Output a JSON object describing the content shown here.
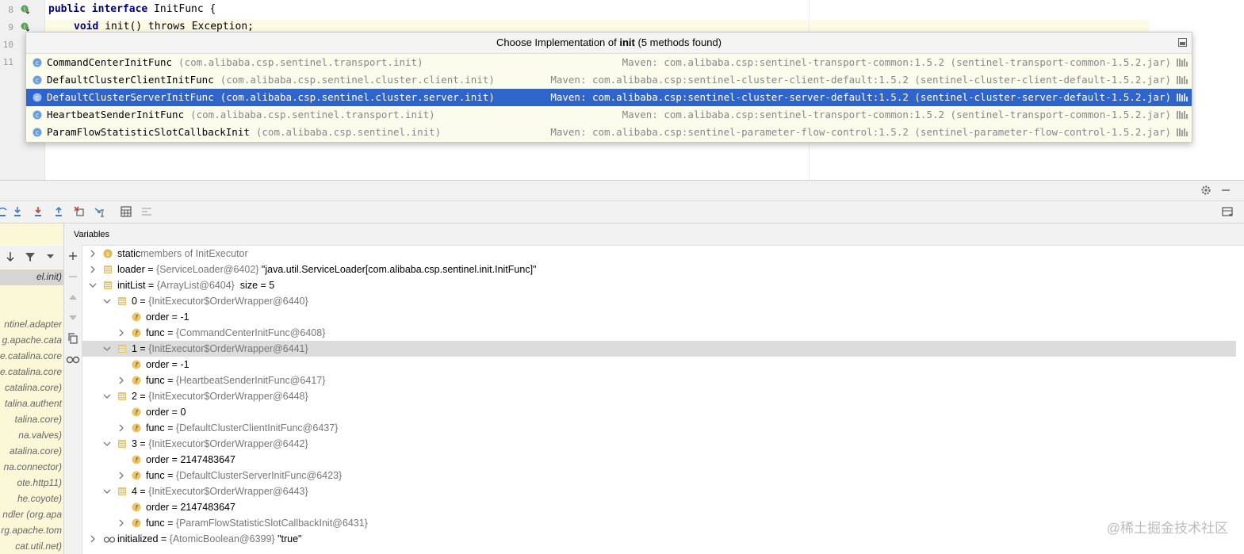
{
  "editor": {
    "lines": [
      {
        "num": "8",
        "code_kw": "public interface",
        "code_rest": " InitFunc {"
      },
      {
        "num": "9",
        "code_kw": "void",
        "code_rest": " init() throws Exception;"
      },
      {
        "num": "10",
        "code_kw": "",
        "code_rest": ""
      },
      {
        "num": "11",
        "code_kw": "",
        "code_rest": ""
      }
    ]
  },
  "popup": {
    "title_prefix": "Choose Implementation of",
    "title_method": "init",
    "title_suffix": "(5 methods found)",
    "items": [
      {
        "name": "CommandCenterInitFunc",
        "package": "(com.alibaba.csp.sentinel.transport.init)",
        "maven": "Maven: com.alibaba.csp:sentinel-transport-common:1.5.2 (sentinel-transport-common-1.5.2.jar)",
        "selected": false
      },
      {
        "name": "DefaultClusterClientInitFunc",
        "package": "(com.alibaba.csp.sentinel.cluster.client.init)",
        "maven": "Maven: com.alibaba.csp:sentinel-cluster-client-default:1.5.2 (sentinel-cluster-client-default-1.5.2.jar)",
        "selected": false
      },
      {
        "name": "DefaultClusterServerInitFunc",
        "package": "(com.alibaba.csp.sentinel.cluster.server.init)",
        "maven": "Maven: com.alibaba.csp:sentinel-cluster-server-default:1.5.2 (sentinel-cluster-server-default-1.5.2.jar)",
        "selected": true
      },
      {
        "name": "HeartbeatSenderInitFunc",
        "package": "(com.alibaba.csp.sentinel.transport.init)",
        "maven": "Maven: com.alibaba.csp:sentinel-transport-common:1.5.2 (sentinel-transport-common-1.5.2.jar)",
        "selected": false
      },
      {
        "name": "ParamFlowStatisticSlotCallbackInit",
        "package": "(com.alibaba.csp.sentinel.init)",
        "maven": "Maven: com.alibaba.csp:sentinel-parameter-flow-control:1.5.2 (sentinel-parameter-flow-control-1.5.2.jar)",
        "selected": false
      }
    ]
  },
  "debugger": {
    "variables_title": "Variables",
    "frames": [
      "el.init)",
      "",
      "",
      "ntinel.adapter",
      "g.apache.cata",
      "e.catalina.core",
      "e.catalina.core",
      "catalina.core)",
      "talina.authent",
      "talina.core)",
      "na.valves)",
      "atalina.core)",
      "na.connector)",
      "ote.http11)",
      "he.coyote)",
      "ndler (org.apa",
      "rg.apache.tom",
      "cat.util.net)"
    ],
    "variables": [
      {
        "level": 0,
        "arrow": "right",
        "icon": "static",
        "name": "static",
        "eq": "",
        "type": "members of InitExecutor",
        "value": "",
        "hl": false
      },
      {
        "level": 0,
        "arrow": "right",
        "icon": "field",
        "name": "loader",
        "eq": " = ",
        "type": "{ServiceLoader@6402}",
        "value": " \"java.util.ServiceLoader[com.alibaba.csp.sentinel.init.InitFunc]\"",
        "hl": false
      },
      {
        "level": 0,
        "arrow": "down",
        "icon": "field",
        "name": "initList",
        "eq": " = ",
        "type": "{ArrayList@6404}",
        "value": "  size = 5",
        "hl": false
      },
      {
        "level": 1,
        "arrow": "down",
        "icon": "field",
        "name": "0",
        "eq": " = ",
        "type": "{InitExecutor$OrderWrapper@6440}",
        "value": "",
        "hl": false
      },
      {
        "level": 2,
        "arrow": "",
        "icon": "f",
        "name": "order",
        "eq": " = ",
        "type": "",
        "value": "-1",
        "hl": false
      },
      {
        "level": 2,
        "arrow": "right",
        "icon": "f",
        "name": "func",
        "eq": " = ",
        "type": "{CommandCenterInitFunc@6408}",
        "value": "",
        "hl": false
      },
      {
        "level": 1,
        "arrow": "down",
        "icon": "field",
        "name": "1",
        "eq": " = ",
        "type": "{InitExecutor$OrderWrapper@6441}",
        "value": "",
        "hl": true
      },
      {
        "level": 2,
        "arrow": "",
        "icon": "f",
        "name": "order",
        "eq": " = ",
        "type": "",
        "value": "-1",
        "hl": false
      },
      {
        "level": 2,
        "arrow": "right",
        "icon": "f",
        "name": "func",
        "eq": " = ",
        "type": "{HeartbeatSenderInitFunc@6417}",
        "value": "",
        "hl": false
      },
      {
        "level": 1,
        "arrow": "down",
        "icon": "field",
        "name": "2",
        "eq": " = ",
        "type": "{InitExecutor$OrderWrapper@6448}",
        "value": "",
        "hl": false
      },
      {
        "level": 2,
        "arrow": "",
        "icon": "f",
        "name": "order",
        "eq": " = ",
        "type": "",
        "value": "0",
        "hl": false
      },
      {
        "level": 2,
        "arrow": "right",
        "icon": "f",
        "name": "func",
        "eq": " = ",
        "type": "{DefaultClusterClientInitFunc@6437}",
        "value": "",
        "hl": false
      },
      {
        "level": 1,
        "arrow": "down",
        "icon": "field",
        "name": "3",
        "eq": " = ",
        "type": "{InitExecutor$OrderWrapper@6442}",
        "value": "",
        "hl": false
      },
      {
        "level": 2,
        "arrow": "",
        "icon": "f",
        "name": "order",
        "eq": " = ",
        "type": "",
        "value": "2147483647",
        "hl": false
      },
      {
        "level": 2,
        "arrow": "right",
        "icon": "f",
        "name": "func",
        "eq": " = ",
        "type": "{DefaultClusterServerInitFunc@6423}",
        "value": "",
        "hl": false
      },
      {
        "level": 1,
        "arrow": "down",
        "icon": "field",
        "name": "4",
        "eq": " = ",
        "type": "{InitExecutor$OrderWrapper@6443}",
        "value": "",
        "hl": false
      },
      {
        "level": 2,
        "arrow": "",
        "icon": "f",
        "name": "order",
        "eq": " = ",
        "type": "",
        "value": "2147483647",
        "hl": false
      },
      {
        "level": 2,
        "arrow": "right",
        "icon": "f",
        "name": "func",
        "eq": " = ",
        "type": "{ParamFlowStatisticSlotCallbackInit@6431}",
        "value": "",
        "hl": false
      },
      {
        "level": 0,
        "arrow": "right",
        "icon": "watch",
        "name": "initialized",
        "eq": " = ",
        "type": "{AtomicBoolean@6399}",
        "value": " \"true\"",
        "hl": false
      }
    ]
  },
  "toolbar_icons": [
    "step-over-icon",
    "step-into-icon",
    "force-step-into-icon",
    "step-out-icon",
    "drop-frame-icon",
    "run-to-cursor-icon",
    "evaluate-icon",
    "trace-icon"
  ],
  "watermark": "@稀土掘金技术社区",
  "colors": {
    "selection": "#2f65ca",
    "keyword": "#000080",
    "popup_bg": "#fcfcec",
    "frames_bg": "#fbf8d8"
  }
}
